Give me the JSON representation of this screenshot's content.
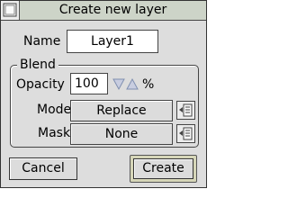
{
  "window": {
    "title": "Create new layer"
  },
  "name_row": {
    "label": "Name",
    "value": "Layer1"
  },
  "blend": {
    "legend": "Blend",
    "opacity": {
      "label": "Opacity",
      "value": "100",
      "unit": "%"
    },
    "mode": {
      "label": "Mode",
      "value": "Replace"
    },
    "mask": {
      "label": "Mask",
      "value": "None"
    }
  },
  "buttons": {
    "cancel": "Cancel",
    "create": "Create"
  },
  "colors": {
    "window_bg": "#dddddd",
    "title_bg": "#cdd4c8",
    "default_button_bg": "#d6d6b8",
    "arrow_blue": "#7f8fb0"
  },
  "icons": {
    "close": "close-icon",
    "menu": "popup-menu-icon",
    "down": "arrow-down-icon",
    "up": "arrow-up-icon"
  }
}
